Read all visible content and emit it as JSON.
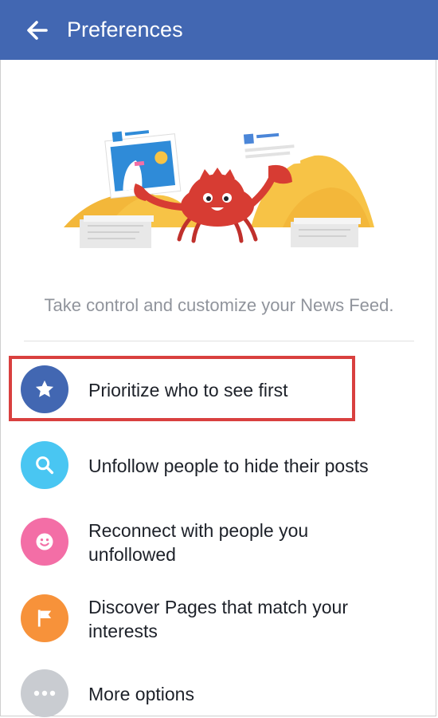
{
  "app_bar": {
    "title": "Preferences",
    "background": "#4267b2",
    "back_icon": "arrow-left-icon"
  },
  "intro_text": "Take control and customize your News Feed.",
  "options": [
    {
      "label_line1": "Prioritize who to see first",
      "label_line2": "",
      "icon": "star-icon",
      "color": "#4267b2",
      "highlighted": true
    },
    {
      "label_line1": "Unfollow people to hide their posts",
      "label_line2": "",
      "icon": "search-icon",
      "color": "#49c6f2"
    },
    {
      "label_line1": "Reconnect with people you",
      "label_line2": "unfollowed",
      "icon": "smiley-icon",
      "color": "#f36ea6"
    },
    {
      "label_line1": "Discover Pages that match your",
      "label_line2": "interests",
      "icon": "flag-icon",
      "color": "#f7923a"
    },
    {
      "label_line1": "More options",
      "label_line2": "",
      "icon": "more-icon",
      "color": "#c9ccd1"
    }
  ],
  "highlight_color": "#d9403f"
}
